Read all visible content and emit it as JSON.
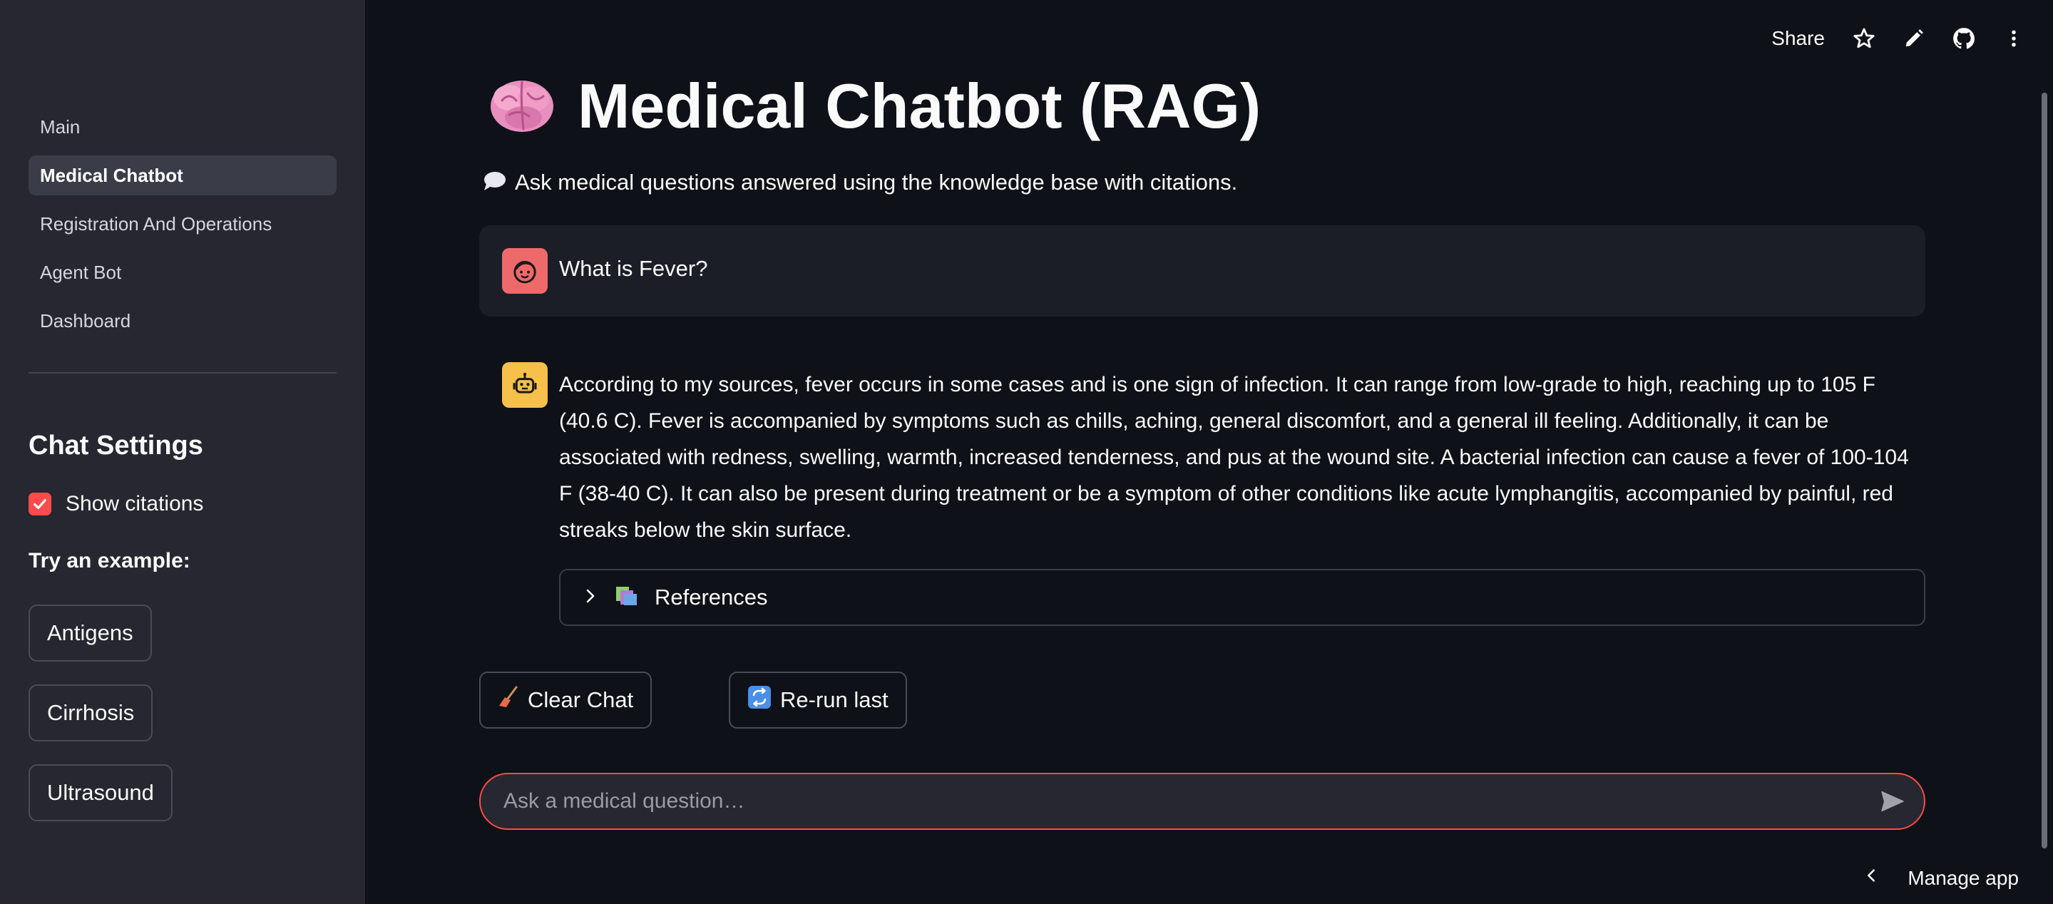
{
  "sidebar": {
    "nav_items": [
      {
        "label": "Main",
        "active": false
      },
      {
        "label": "Medical Chatbot",
        "active": true
      },
      {
        "label": "Registration And Operations",
        "active": false
      },
      {
        "label": "Agent Bot",
        "active": false
      },
      {
        "label": "Dashboard",
        "active": false
      }
    ],
    "settings_title": "Chat Settings",
    "show_citations": {
      "label": "Show citations",
      "checked": true
    },
    "try_label": "Try an example:",
    "examples": [
      "Antigens",
      "Cirrhosis",
      "Ultrasound"
    ]
  },
  "toolbar": {
    "share_label": "Share",
    "icons": [
      "star-icon",
      "pencil-icon",
      "github-icon",
      "more-vertical-icon"
    ]
  },
  "main": {
    "title": "Medical Chatbot (RAG)",
    "title_icon": "brain-icon",
    "subtitle": "Ask medical questions answered using the knowledge base with citations.",
    "subtitle_icon": "speech-bubble-icon",
    "user_message": "What is Fever?",
    "bot_message": "According to my sources, fever occurs in some cases and is one sign of infection. It can range from low-grade to high, reaching up to 105 F (40.6 C). Fever is accompanied by symptoms such as chills, aching, general discomfort, and a general ill feeling. Additionally, it can be associated with redness, swelling, warmth, increased tenderness, and pus at the wound site. A bacterial infection can cause a fever of 100-104 F (38-40 C). It can also be present during treatment or be a symptom of other conditions like acute lymphangitis, accompanied by painful, red streaks below the skin surface.",
    "references_label": "References",
    "clear_chat_label": "Clear Chat",
    "rerun_label": "Re-run last",
    "chat_input_placeholder": "Ask a medical question…"
  },
  "footer": {
    "manage_app_label": "Manage app"
  },
  "colors": {
    "background": "#0e1117",
    "sidebar": "#262730",
    "accent": "#ff4b4b",
    "user_avatar": "#ee6a6a",
    "bot_avatar": "#f7c04a"
  }
}
